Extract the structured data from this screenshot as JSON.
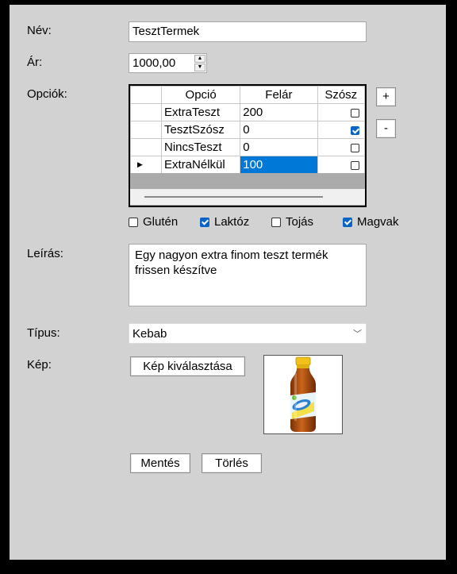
{
  "labels": {
    "name": "Név:",
    "price": "Ár:",
    "options": "Opciók:",
    "description": "Leírás:",
    "type": "Típus:",
    "image": "Kép:"
  },
  "name_value": "TesztTermek",
  "price_value": "1000,00",
  "grid": {
    "columns": [
      "Opció",
      "Felár",
      "Szósz"
    ],
    "rows": [
      {
        "option": "ExtraTeszt",
        "extra": "200",
        "sauce": false
      },
      {
        "option": "TesztSzósz",
        "extra": "0",
        "sauce": true
      },
      {
        "option": "NincsTeszt",
        "extra": "0",
        "sauce": false
      },
      {
        "option": "ExtraNélkül",
        "extra": "100",
        "sauce": false
      }
    ],
    "add_label": "+",
    "remove_label": "-"
  },
  "allergens": [
    {
      "label": "Glutén",
      "checked": false
    },
    {
      "label": "Laktóz",
      "checked": true
    },
    {
      "label": "Tojás",
      "checked": false
    },
    {
      "label": "Magvak",
      "checked": true
    }
  ],
  "description_value": "Egy nagyon extra finom teszt termék frissen készítve",
  "type_value": "Kebab",
  "choose_image_label": "Kép kiválasztása",
  "save_label": "Mentés",
  "delete_label": "Törlés",
  "icons": {
    "spin_up": "up-arrow-icon",
    "spin_down": "down-arrow-icon",
    "combo_arrow": "chevron-down-icon",
    "current_row": "row-pointer-icon"
  },
  "colors": {
    "form_background": "#d2d2d2",
    "selection": "#0078d7",
    "checkbox_checked": "#0a64c8"
  }
}
